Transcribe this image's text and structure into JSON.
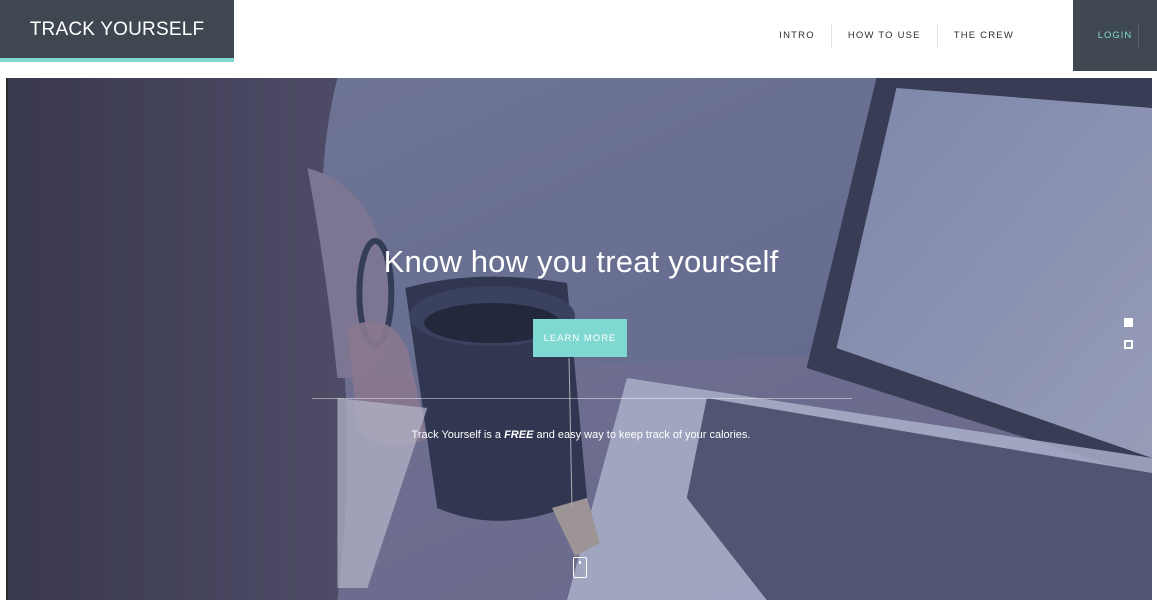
{
  "brand": {
    "title": "TRACK YOURSELF"
  },
  "nav": {
    "items": [
      {
        "label": "INTRO"
      },
      {
        "label": "HOW TO USE"
      },
      {
        "label": "THE CREW"
      }
    ],
    "login": "LOGIN"
  },
  "hero": {
    "headline": "Know how you treat yourself",
    "cta": "LEARN MORE",
    "tagline_prefix": "Track Yourself is a ",
    "tagline_emphasis": "FREE",
    "tagline_suffix": " and easy way to keep track of your calories.",
    "slides": {
      "count": 2,
      "active": 1
    }
  },
  "colors": {
    "brand_dark": "#3f4850",
    "accent_teal": "#7fd8d2",
    "hero_overlay": "#5a608c"
  },
  "icons": {
    "scroll": "mouse-scroll-icon"
  }
}
